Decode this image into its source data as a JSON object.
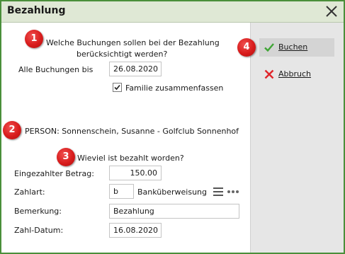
{
  "window": {
    "title": "Bezahlung"
  },
  "section_bookings": {
    "heading_line1": "Welche Buchungen sollen bei der Bezahlung",
    "heading_line2": "berücksichtigt werden?",
    "all_until_label": "Alle Buchungen bis",
    "all_until_value": "26.08.2020",
    "family_checkbox_label": "Familie zusammenfassen",
    "family_checked": true
  },
  "person": {
    "text": "PERSON: Sonnenschein, Susanne - Golfclub Sonnenhof"
  },
  "section_payment": {
    "heading": "Wieviel ist bezahlt worden?",
    "amount_label": "Eingezahlter Betrag:",
    "amount_value": "150.00",
    "pay_type_label": "Zahlart:",
    "pay_type_code": "b",
    "pay_type_name": "Banküberweisung",
    "remark_label": "Bemerkung:",
    "remark_value": "Bezahlung",
    "pay_date_label": "Zahl-Datum:",
    "pay_date_value": "16.08.2020"
  },
  "badges": [
    "1",
    "2",
    "3",
    "4"
  ],
  "actions": {
    "book_label": "Buchen",
    "cancel_label": "Abbruch"
  },
  "colors": {
    "accent_green": "#4a8f3a",
    "badge_red": "#d81c1c",
    "check_green": "#3fa535",
    "cancel_red": "#e0262b"
  }
}
